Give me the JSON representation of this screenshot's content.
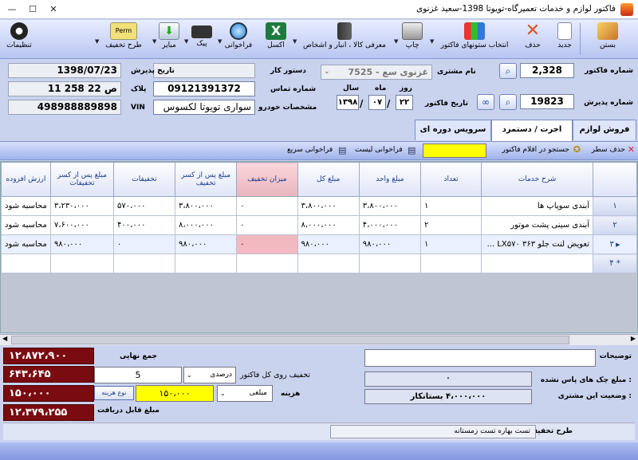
{
  "window": {
    "title": "فاکتور لوازم و خدمات تعمیرگاه-تویوتا 1398-سعید غزنوی",
    "min": "—",
    "max": "☐",
    "close": "✕"
  },
  "toolbar": {
    "new_label": "جدید",
    "delete_label": "حذف",
    "columns_label": "انتخاب ستونهای فاکتور",
    "print_label": "چاپ",
    "entities_label": "معرفی کالا ، انبار و اشخاص",
    "excel_label": "اکسل",
    "recall_label": "فراخوانی",
    "peyk_label": "پیک",
    "mabair_label": "مبایر",
    "discount_plan_label": "طرح تخفیف",
    "settings_label": "تنظیمات",
    "close_label": "بستن",
    "discount_plan_tag": "Perm"
  },
  "header": {
    "invoice_no_label": "شماره فاکتور",
    "invoice_no": "2,328",
    "reception_no_label": "شماره پذیرش",
    "reception_no": "19823",
    "customer_label": "نام مشتری",
    "customer": "7525 - غزنوی سع",
    "invoice_date_label": "تاریخ فاکتور",
    "day_label": "روز",
    "month_label": "ماه",
    "year_label": "سال",
    "day": "۲۲",
    "month": "۰۷",
    "year": "۱۳۹۸",
    "work_order_label": "دستور کار",
    "contact_label": "شماره تماس",
    "vehicle_spec_label": "مشخصات خودرو",
    "phone": "09121391372",
    "vehicle": "سواری تویوتا لکسوس",
    "reception_date_label": "تاریخ پذیرش",
    "reception_date": "1398/07/23",
    "plate_label": "پلاک",
    "plate": "11 258 ص 22",
    "vin_label": "VIN",
    "vin": "498988889898"
  },
  "tabs": {
    "parts": "فروش لوازم",
    "labor": "اجرت / دستمزد",
    "periodic": "سرویس دوره ای"
  },
  "subbar": {
    "delete_row": "حذف سطر",
    "search_label": "جستجو در اقلام فاکتور",
    "recall_list": "فراخوانی لیست",
    "quick_recall": "فراخوانی سریع"
  },
  "grid": {
    "columns": [
      "شرح خدمات",
      "تعداد",
      "مبلغ واحد",
      "مبلغ کل",
      "میزان تخفیف",
      "مبلغ پس از کسر تخفیف",
      "تخفیفات",
      "مبلغ پس از کسر تخفیفات",
      "ارزش افزوده"
    ],
    "rows": [
      {
        "no": "۱",
        "desc": "آبندی سوپاپ ها",
        "qty": "۱",
        "unit": "۳،۸۰۰،۰۰۰",
        "total": "۳،۸۰۰،۰۰۰",
        "disc": "۰",
        "after": "۳،۸۰۰،۰۰۰",
        "discounts": "۵۷۰،۰۰۰",
        "after2": "۳،۲۳۰،۰۰۰",
        "vat": "محاسبه شود"
      },
      {
        "no": "۲",
        "desc": "آبندی سینی پشت موتور",
        "qty": "۲",
        "unit": "۴،۰۰۰،۰۰۰",
        "total": "۸،۰۰۰،۰۰۰",
        "disc": "۰",
        "after": "۸،۰۰۰،۰۰۰",
        "discounts": "۴۰۰،۰۰۰",
        "after2": "۷،۶۰۰،۰۰۰",
        "vat": "محاسبه شود"
      },
      {
        "no": "۳",
        "desc": "تعویض لنت جلو LX۵۷۰ ۳۶۳ ...",
        "qty": "۱",
        "unit": "۹۸۰،۰۰۰",
        "total": "۹۸۰،۰۰۰",
        "disc": "۰",
        "after": "۹۸۰،۰۰۰",
        "discounts": "۰",
        "after2": "۹۸۰،۰۰۰",
        "vat": "محاسبه شود"
      },
      {
        "no": "۴",
        "desc": "",
        "qty": "",
        "unit": "",
        "total": "",
        "disc": "",
        "after": "",
        "discounts": "",
        "after2": "",
        "vat": ""
      }
    ]
  },
  "summary": {
    "final_total_label": "جمع نهایی",
    "final_total": "۱۲،۸۷۲،۹۰۰",
    "vat_value": "۶۴۳،۶۴۵",
    "cost_value": "۱۵۰،۰۰۰",
    "receivable_label": "مبلغ قابل دریافت",
    "receivable": "۱۲،۳۷۹،۲۵۵",
    "discount_label": "تخفیف  روی کل فاکتور",
    "discount_value": "5",
    "discount_type": "درصدی",
    "cost_label": "هزینه",
    "cost_input": "۱۵۰،۰۰۰",
    "cost_type": "مبلغی",
    "cost_type_btn": "نوع هزینه",
    "notes_label": "توضیحات",
    "notes": "",
    "unpaid_checks_label": "مبلغ چک های پاس نشده :",
    "unpaid_checks": "۰",
    "customer_status_label": "وضعیت این مشتری :",
    "customer_status": "۴،۰۰۰،۰۰۰   بستانکار",
    "discount_plan_label": "طرح تخفیف",
    "discount_plan": "تست بهاره  تست زمستانه"
  },
  "colors": {
    "accent": "#2d3fcf",
    "total_bg": "#7a0b10",
    "highlight": "#ffff00"
  }
}
